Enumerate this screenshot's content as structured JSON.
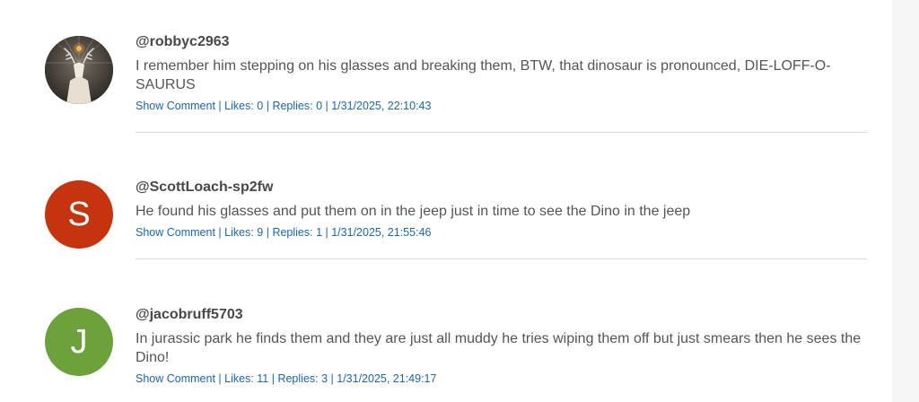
{
  "comments": [
    {
      "username": "@robbyc2963",
      "avatar_type": "image",
      "avatar_initial": "",
      "avatar_color": "#3c3a36",
      "text": "I remember him stepping on his glasses and breaking them, BTW, that dinosaur is pronounced, DIE-LOFF-O-SAURUS",
      "show_comment": "Show Comment",
      "likes": "Likes: 0",
      "replies": "Replies: 0",
      "timestamp": "1/31/2025, 22:10:43"
    },
    {
      "username": "@ScottLoach-sp2fw",
      "avatar_type": "letter",
      "avatar_initial": "S",
      "avatar_color": "#c5340e",
      "text": "He found his glasses and put them on in the jeep just in time to see the Dino in the jeep",
      "show_comment": "Show Comment",
      "likes": "Likes: 9",
      "replies": "Replies: 1",
      "timestamp": "1/31/2025, 21:55:46"
    },
    {
      "username": "@jacobruff5703",
      "avatar_type": "letter",
      "avatar_initial": "J",
      "avatar_color": "#6ca13b",
      "text": "In jurassic park he finds them and they are just all muddy he tries wiping them off but just smears then he sees the Dino!",
      "show_comment": "Show Comment",
      "likes": "Likes: 11",
      "replies": "Replies: 3",
      "timestamp": "1/31/2025, 21:49:17"
    }
  ],
  "separator": " | "
}
